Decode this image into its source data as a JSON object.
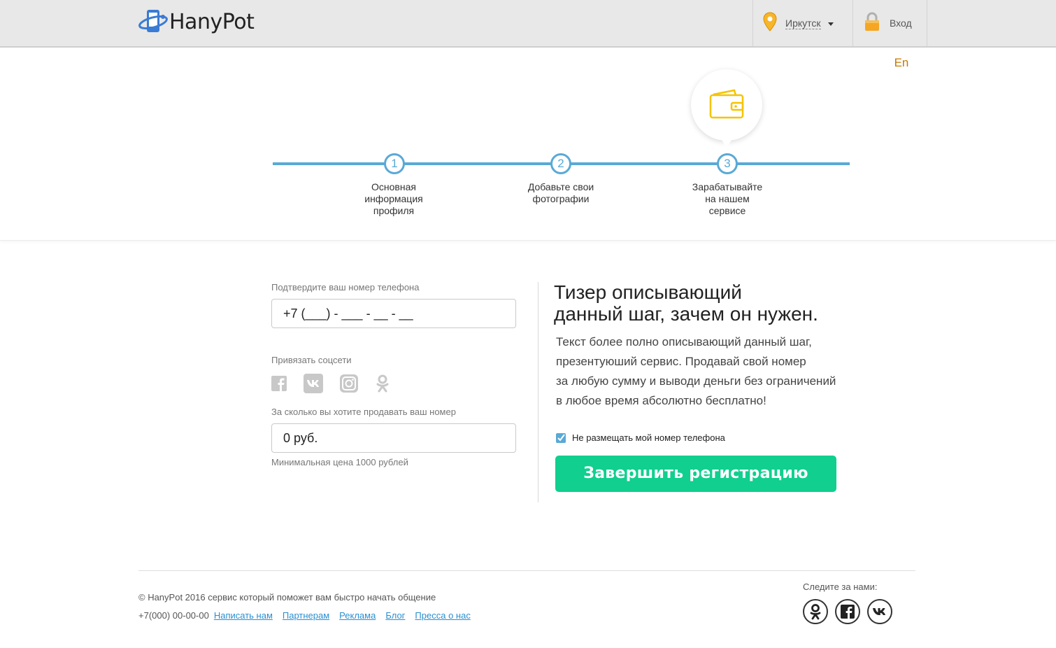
{
  "header": {
    "logo_text": "HanyPot",
    "city": "Иркутск",
    "login": "Вход",
    "lang": "En"
  },
  "steps": [
    {
      "number": "1",
      "label_lines": [
        "Основная",
        "информация",
        "профиля"
      ]
    },
    {
      "number": "2",
      "label_lines": [
        "Добавьте свои",
        "фотографии"
      ]
    },
    {
      "number": "3",
      "label_lines": [
        "Зарабатывайте",
        "на нашем",
        "сервисе"
      ]
    }
  ],
  "form": {
    "phone_label": "Подтвердите ваш номер телефона",
    "phone_value": "+7 (___) - ___ - __ - __",
    "social_label": "Привязать соцсети",
    "social_icons": [
      "facebook-icon",
      "vk-icon",
      "instagram-icon",
      "odnoklassniki-icon"
    ],
    "price_label": "За сколько вы хотите продавать ваш номер",
    "price_value": "0 руб.",
    "price_hint": "Минимальная цена 1000 рублей"
  },
  "teaser": {
    "title_line1": "Тизер описывающий",
    "title_line2": "данный шаг, зачем он нужен.",
    "text_lines": [
      "Текст более полно описывающий данный шаг,",
      "презентуюший сервис. Продавай свой номер",
      "за любую сумму и выводи деньги без ограничений",
      "в любое время абсолютно бесплатно!"
    ],
    "checkbox_label": "Не размещать мой номер телефона",
    "submit": "Завершить регистрацию"
  },
  "footer": {
    "copyright": "© HanyPot 2016 сервис который поможет вам быстро начать общение",
    "phone": "+7(000) 00-00-00",
    "links": [
      "Написать нам",
      "Партнерам",
      "Реклама",
      "Блог",
      "Пресса о нас"
    ],
    "follow_label": "Следите за нами:",
    "follow_icons": [
      "odnoklassniki-icon",
      "facebook-icon",
      "vk-icon"
    ]
  },
  "colors": {
    "accent_blue": "#5aa9d6",
    "cta_green": "#10cf8f",
    "ribbon_yellow": "#fbbd2e",
    "wallet_yellow": "#f5c400"
  }
}
